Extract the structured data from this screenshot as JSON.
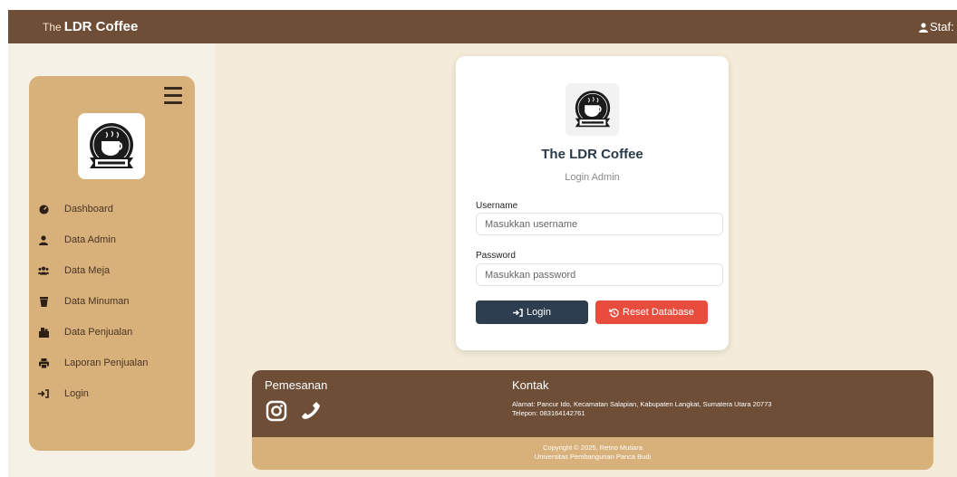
{
  "topbar": {
    "brand_prefix": "The",
    "brand_name": "LDR Coffee",
    "user_label": "Staf:"
  },
  "sidebar": {
    "items": [
      {
        "label": "Dashboard",
        "icon": "dashboard-icon"
      },
      {
        "label": "Data Admin",
        "icon": "user-icon"
      },
      {
        "label": "Data Meja",
        "icon": "users-icon"
      },
      {
        "label": "Data Minuman",
        "icon": "drink-icon"
      },
      {
        "label": "Data Penjualan",
        "icon": "boxes-icon"
      },
      {
        "label": "Laporan Penjualan",
        "icon": "print-icon"
      },
      {
        "label": "Login",
        "icon": "login-icon"
      }
    ]
  },
  "login_card": {
    "title": "The LDR Coffee",
    "subtitle": "Login Admin",
    "username_label": "Username",
    "username_placeholder": "Masukkan username",
    "username_value": "",
    "password_label": "Password",
    "password_placeholder": "Masukkan password",
    "password_value": "",
    "login_button": "Login",
    "reset_button": "Reset Database"
  },
  "footer": {
    "ordering_heading": "Pemesanan",
    "contact_heading": "Kontak",
    "address": "Alamat: Pancur Ido, Kecamatan Salapian, Kabupaten Langkat, Sumatera Utara 20773",
    "phone": "Telepon: 083164142761",
    "copyright": "Copyright © 2025, Retno Mutiara",
    "university": "Universitas Pembangunan Panca Budi"
  },
  "colors": {
    "brown": "#6f4e37",
    "tan": "#d7b07a",
    "cream": "#f4ecd8",
    "navy_button": "#2c3e50",
    "red_button": "#e74c3c"
  }
}
